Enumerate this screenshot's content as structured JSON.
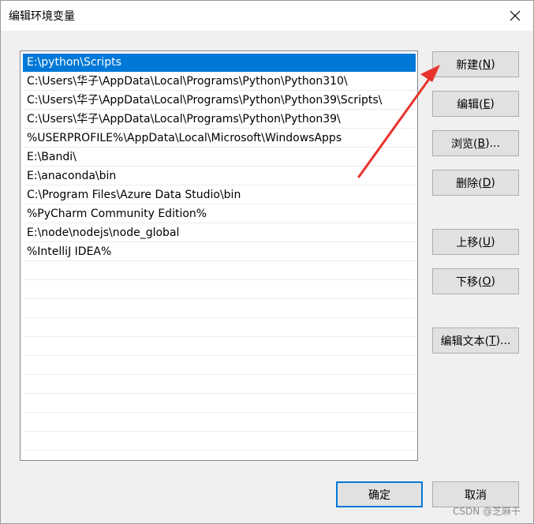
{
  "window": {
    "title": "编辑环境变量"
  },
  "list": {
    "items": [
      "E:\\python\\Scripts",
      "C:\\Users\\华子\\AppData\\Local\\Programs\\Python\\Python310\\",
      "C:\\Users\\华子\\AppData\\Local\\Programs\\Python\\Python39\\Scripts\\",
      "C:\\Users\\华子\\AppData\\Local\\Programs\\Python\\Python39\\",
      "%USERPROFILE%\\AppData\\Local\\Microsoft\\WindowsApps",
      "E:\\Bandi\\",
      "E:\\anaconda\\bin",
      "C:\\Program Files\\Azure Data Studio\\bin",
      "%PyCharm Community Edition%",
      "E:\\node\\nodejs\\node_global",
      "%IntelliJ IDEA%",
      "",
      "",
      "",
      "",
      "",
      "",
      "",
      "",
      "",
      ""
    ],
    "selected_index": 0
  },
  "buttons": {
    "new": {
      "label": "新建(",
      "key": "N",
      "suffix": ")"
    },
    "edit": {
      "label": "编辑(",
      "key": "E",
      "suffix": ")"
    },
    "browse": {
      "label": "浏览(",
      "key": "B",
      "suffix": ")..."
    },
    "delete": {
      "label": "删除(",
      "key": "D",
      "suffix": ")"
    },
    "move_up": {
      "label": "上移(",
      "key": "U",
      "suffix": ")"
    },
    "move_down": {
      "label": "下移(",
      "key": "O",
      "suffix": ")"
    },
    "edit_text": {
      "label": "编辑文本(",
      "key": "T",
      "suffix": ")..."
    },
    "ok": "确定",
    "cancel": "取消"
  },
  "watermark": "CSDN @芝麻干",
  "colors": {
    "selection": "#0078d7",
    "annotation_arrow": "#e8332c"
  },
  "icons": {
    "close": "close-icon"
  }
}
